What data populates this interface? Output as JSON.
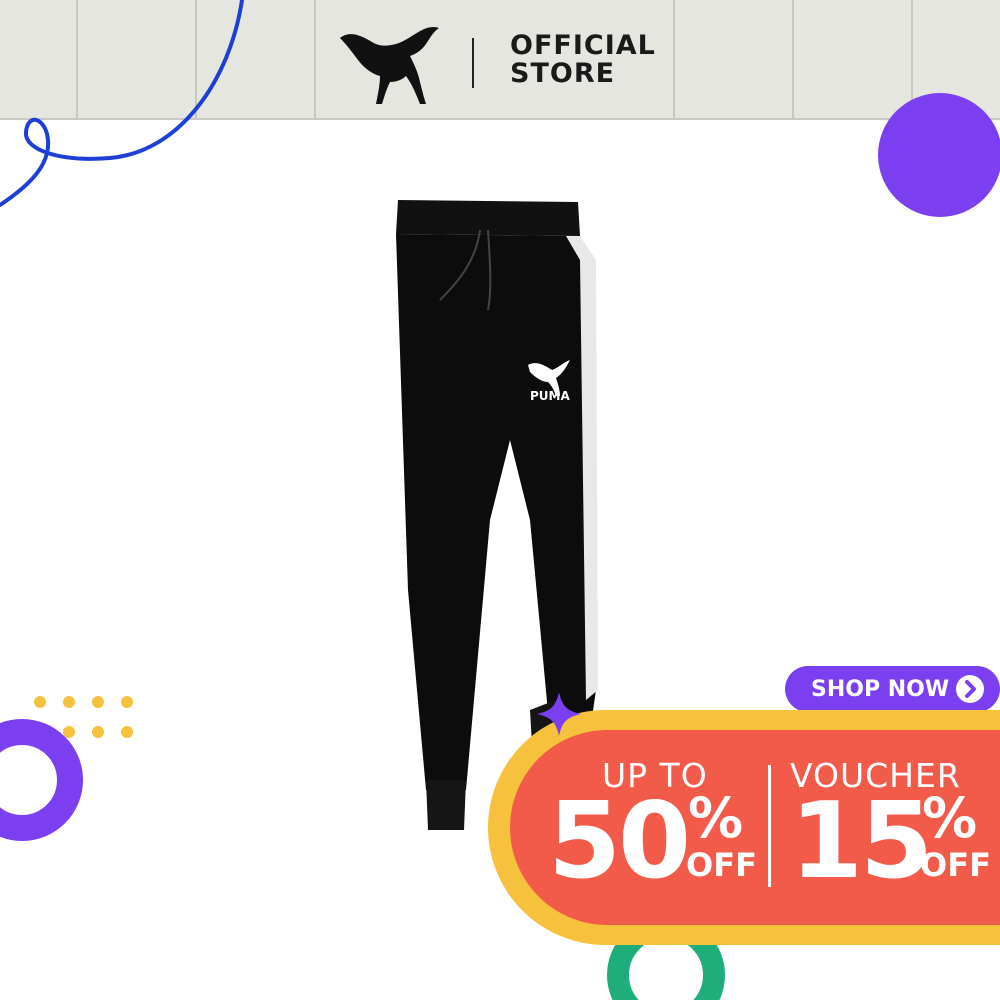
{
  "header": {
    "store_line1": "OFFICIAL",
    "store_line2": "STORE",
    "brand_icon": "puma-cat-icon"
  },
  "product": {
    "logo_text": "PUMA",
    "image_icon": "track-pants-image"
  },
  "cta": {
    "label": "SHOP NOW",
    "icon": "chevron-right-icon"
  },
  "promo": {
    "left_label": "UP TO",
    "left_value": "50",
    "left_percent": "%",
    "left_off": "OFF",
    "right_label": "VOUCHER",
    "right_value": "15",
    "right_percent": "%",
    "right_off": "OFF"
  },
  "colors": {
    "header_bg": "#e6e6e1",
    "accent_purple": "#7b3ff0",
    "promo_yellow": "#f6c23d",
    "promo_red": "#f25a4a",
    "green": "#1fae7a",
    "blue_line": "#1d3fd6"
  }
}
